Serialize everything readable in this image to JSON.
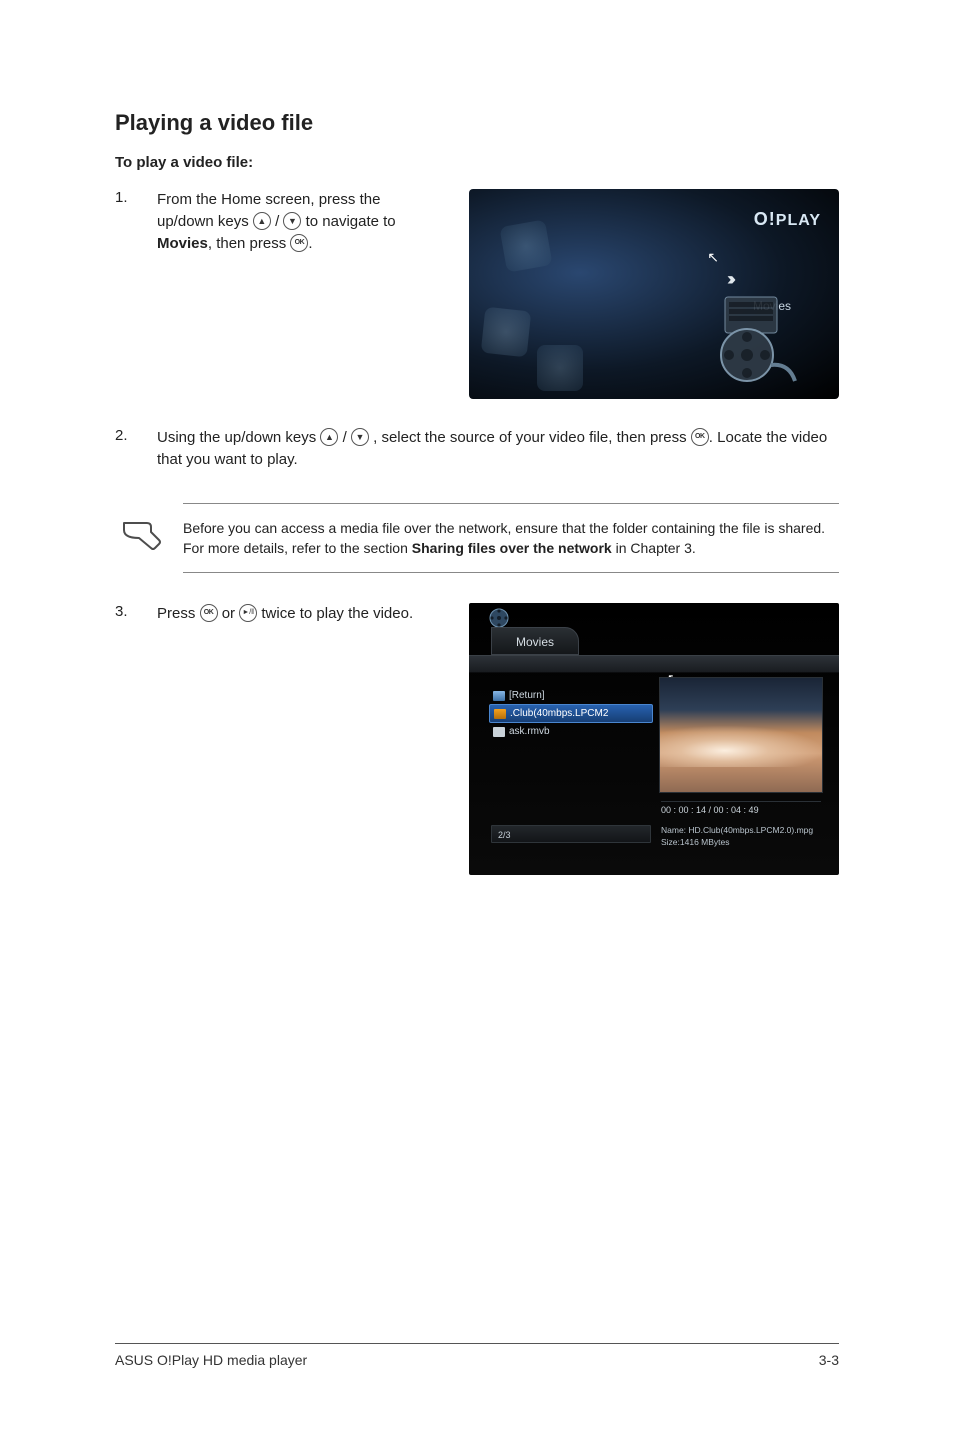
{
  "section_title": "Playing a video file",
  "sub_title": "To play a video file:",
  "steps": {
    "s1": {
      "num": "1.",
      "t1": "From the Home screen, press the up/down keys ",
      "t2": " / ",
      "t3": " to navigate to ",
      "bold": "Movies",
      "t4": ", then press ",
      "t5": "."
    },
    "s2": {
      "num": "2.",
      "t1": "Using the up/down keys ",
      "t2": " / ",
      "t3": ", select the source of your video file, then press ",
      "t4": ". Locate the video that you want to play."
    },
    "s3": {
      "num": "3.",
      "t1": "Press ",
      "t2": " or ",
      "t3": " twice to play the video."
    }
  },
  "note": {
    "t1": "Before you can access a media file over the network, ensure that the folder containing the file is shared. For more details, refer to the section ",
    "bold": "Sharing files over the network",
    "t2": " in Chapter 3."
  },
  "screenshot1": {
    "logo": "O!PLAY",
    "movies_label": "Movies",
    "chevrons": "››››"
  },
  "screenshot2": {
    "tab": "Movies",
    "files": {
      "return": "[Return]",
      "selected": ".Club(40mbps.LPCM2",
      "other": "ask.rmvb"
    },
    "timecode": "00 : 00 : 14 / 00 : 04 : 49",
    "meta_name": "Name: HD.Club(40mbps.LPCM2.0).mpg",
    "meta_size": "Size:1416 MBytes",
    "pager": "2/3"
  },
  "icons": {
    "up": "▲",
    "down": "▼",
    "ok": "OK",
    "play": "►/ǁ"
  },
  "footer": {
    "left": "ASUS O!Play HD media player",
    "right": "3-3"
  }
}
